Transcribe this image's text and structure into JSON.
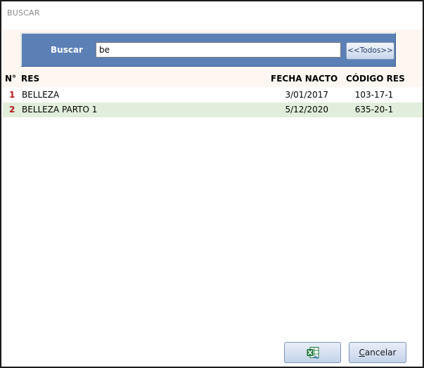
{
  "window": {
    "title": "BUSCAR"
  },
  "search": {
    "label": "Buscar",
    "value": "be",
    "todos_label": "<<Todos>>"
  },
  "table": {
    "headers": {
      "num": "N°",
      "res": "RES",
      "fecha": "FECHA NACTO",
      "codigo": "CÓDIGO RES"
    },
    "rows": [
      {
        "num": "1",
        "res": "BELLEZA",
        "fecha": "3/01/2017",
        "codigo": "103-17-1"
      },
      {
        "num": "2",
        "res": "BELLEZA PARTO 1",
        "fecha": "5/12/2020",
        "codigo": "635-20-1"
      }
    ]
  },
  "footer": {
    "excel_icon": "excel-export-icon",
    "cancel_first": "C",
    "cancel_rest": "ancelar"
  },
  "colors": {
    "panel": "#5b80b6",
    "row_alt": "#e1eedb",
    "row_number": "#b51c1c",
    "excel_green": "#1f7a3a"
  }
}
